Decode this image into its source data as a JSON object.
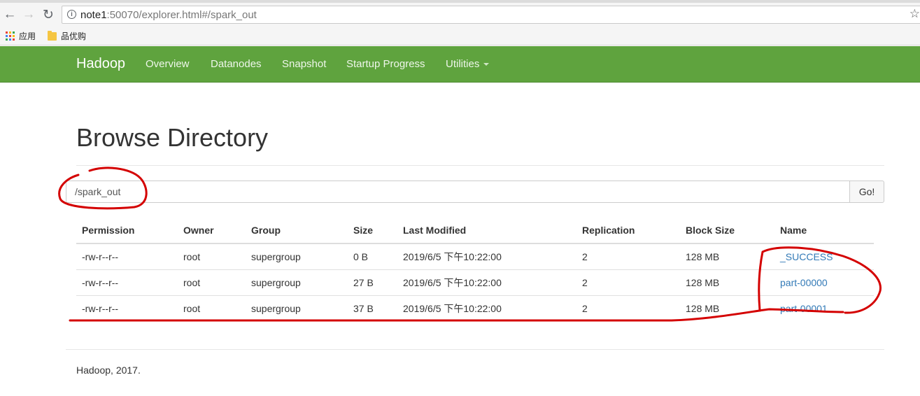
{
  "browser": {
    "url_host": "note1",
    "url_rest": ":50070/explorer.html#/spark_out",
    "bookmarks": [
      "应用",
      "品优购"
    ]
  },
  "navbar": {
    "brand": "Hadoop",
    "links": [
      "Overview",
      "Datanodes",
      "Snapshot",
      "Startup Progress",
      "Utilities"
    ],
    "bg_color": "#5fa33e"
  },
  "main": {
    "title": "Browse Directory",
    "path_value": "/spark_out",
    "go_label": "Go!"
  },
  "table": {
    "headers": [
      "Permission",
      "Owner",
      "Group",
      "Size",
      "Last Modified",
      "Replication",
      "Block Size",
      "Name"
    ],
    "rows": [
      [
        "-rw-r--r--",
        "root",
        "supergroup",
        "0 B",
        "2019/6/5 下午10:22:00",
        "2",
        "128 MB",
        "_SUCCESS"
      ],
      [
        "-rw-r--r--",
        "root",
        "supergroup",
        "27 B",
        "2019/6/5 下午10:22:00",
        "2",
        "128 MB",
        "part-00000"
      ],
      [
        "-rw-r--r--",
        "root",
        "supergroup",
        "37 B",
        "2019/6/5 下午10:22:00",
        "2",
        "128 MB",
        "part-00001"
      ]
    ]
  },
  "footer": "Hadoop, 2017.",
  "colors": {
    "link": "#337ab7",
    "annotation": "#d40000"
  }
}
